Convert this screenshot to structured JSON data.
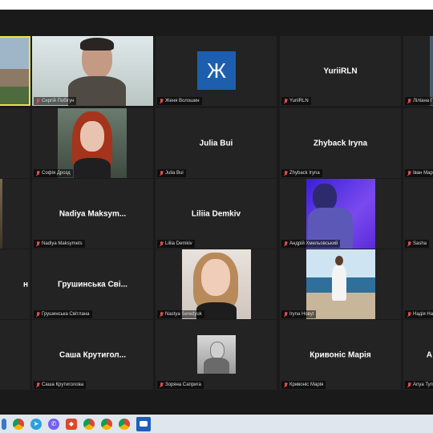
{
  "tiles": [
    {
      "name": "",
      "center": ""
    },
    {
      "name": "Сергій Побігун",
      "center": ""
    },
    {
      "name": "Женя Волошин",
      "center": "",
      "avatar_letter": "Ж"
    },
    {
      "name": "YuriiRLN",
      "center": "YuriiRLN"
    },
    {
      "name": "Ліліана Гор",
      "center": ""
    },
    {
      "name": "",
      "center": ""
    },
    {
      "name": "Софія Дрозд",
      "center": ""
    },
    {
      "name": "Julia Bui",
      "center": "Julia Bui"
    },
    {
      "name": "Zhyback Iryna",
      "center": "Zhyback Iryna"
    },
    {
      "name": "Іван Мар",
      "center": ""
    },
    {
      "name": "",
      "center": ""
    },
    {
      "name": "Nadiya Maksymets",
      "center": "Nadiya  Maksym..."
    },
    {
      "name": "Liliia Demkiv",
      "center": "Liliia Demkiv"
    },
    {
      "name": "Андрій Хмельовський",
      "center": ""
    },
    {
      "name": "Sasha",
      "center": ""
    },
    {
      "name": "",
      "center": "н"
    },
    {
      "name": "Грушинська Світлана",
      "center": "Грушинська  Сві..."
    },
    {
      "name": "Nastya Seredyuk",
      "center": ""
    },
    {
      "name": "Iryna Новуt",
      "center": ""
    },
    {
      "name": "Надія На",
      "center": ""
    },
    {
      "name": "",
      "center": ""
    },
    {
      "name": "Саша Крутиголова",
      "center": "Саша  Крутигол..."
    },
    {
      "name": "Зоряна Саприга",
      "center": ""
    },
    {
      "name": "Кривоніс Марія",
      "center": "Кривоніс Марія"
    },
    {
      "name": "Anya Туп",
      "center": "А"
    }
  ],
  "taskbar": {
    "icons": [
      "folder-icon",
      "chrome-icon",
      "telegram-icon",
      "viber-icon",
      "app-icon",
      "chrome-icon",
      "chrome-icon",
      "chrome-icon",
      "zoom-icon"
    ]
  }
}
